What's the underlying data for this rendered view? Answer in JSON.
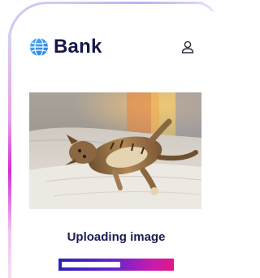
{
  "app": {
    "title": "Bank"
  },
  "header": {
    "logo_icon": "globe-icon",
    "user_icon": "user-icon"
  },
  "main": {
    "image_description_icon": "photo",
    "status_text": "Uploading image",
    "upload_progress": 0.54
  },
  "colors": {
    "brand_text": "#16164a",
    "progress_start": "#2c22b8",
    "progress_end": "#e0188c"
  }
}
